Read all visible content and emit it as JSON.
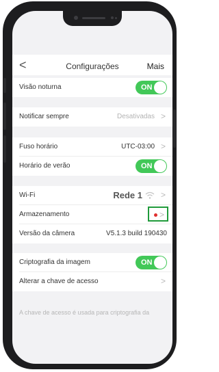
{
  "nav": {
    "back": "<",
    "title": "Configurações",
    "more": "Mais"
  },
  "rows": {
    "night_vision": {
      "label": "Visão noturna",
      "toggle": "ON"
    },
    "notify_always": {
      "label": "Notificar sempre",
      "value": "Desativadas"
    },
    "timezone": {
      "label": "Fuso horário",
      "value": "UTC-03:00"
    },
    "dst": {
      "label": "Horário de verão",
      "toggle": "ON"
    },
    "wifi": {
      "label": "Wi-Fi",
      "value": "Rede 1"
    },
    "storage": {
      "label": "Armazenamento"
    },
    "camera_version": {
      "label": "Versão da câmera",
      "value": "V5.1.3 build 190430"
    },
    "image_encryption": {
      "label": "Criptografia da imagem",
      "toggle": "ON"
    },
    "change_key": {
      "label": "Alterar a chave de acesso"
    }
  },
  "footer_note": "A chave de acesso é usada para criptografia da",
  "chevron": ">",
  "colors": {
    "toggle_on": "#42c858",
    "highlight_box": "#1f9a3a",
    "status_dot": "#e0302f"
  },
  "icons": {
    "wifi": "wifi-icon",
    "status": "red-dot-icon"
  }
}
